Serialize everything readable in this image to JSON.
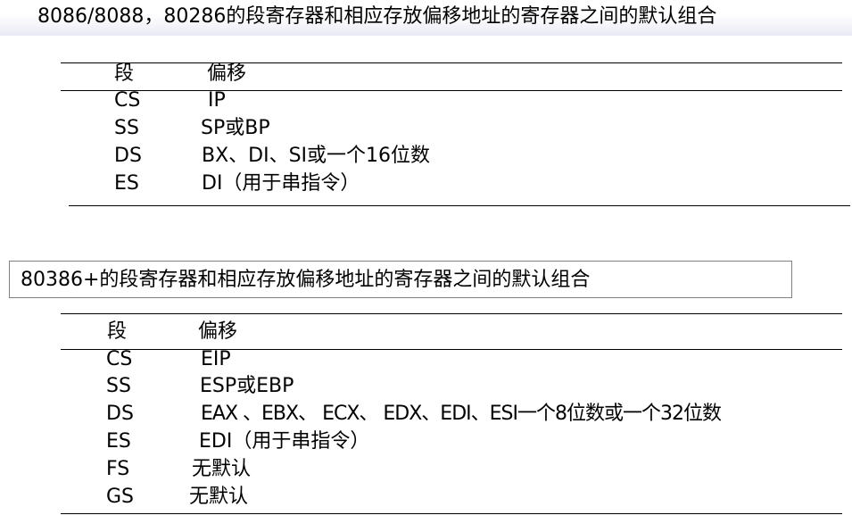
{
  "title1": "8086/8088，80286的段寄存器和相应存放偏移地址的寄存器之间的默认组合",
  "table1": {
    "header": {
      "segment": "段",
      "offset": "偏移"
    },
    "rows": [
      {
        "segment": "CS",
        "offset": "IP"
      },
      {
        "segment": "SS",
        "offset": "SP或BP"
      },
      {
        "segment": "DS",
        "offset": "BX、DI、SI或一个16位数"
      },
      {
        "segment": "ES",
        "offset": "DI（用于串指令）"
      }
    ]
  },
  "title2": "80386+的段寄存器和相应存放偏移地址的寄存器之间的默认组合",
  "table2": {
    "header": {
      "segment": "段",
      "offset": "偏移"
    },
    "rows": [
      {
        "segment": "CS",
        "offset": "EIP"
      },
      {
        "segment": "SS",
        "offset": "ESP或EBP"
      },
      {
        "segment": "DS",
        "offset": "EAX 、EBX、 ECX、 EDX、EDI、ESI一个8位数或一个32位数"
      },
      {
        "segment": "ES",
        "offset": "EDI（用于串指令）"
      },
      {
        "segment": "FS",
        "offset": "无默认"
      },
      {
        "segment": "GS",
        "offset": "无默认"
      }
    ]
  }
}
